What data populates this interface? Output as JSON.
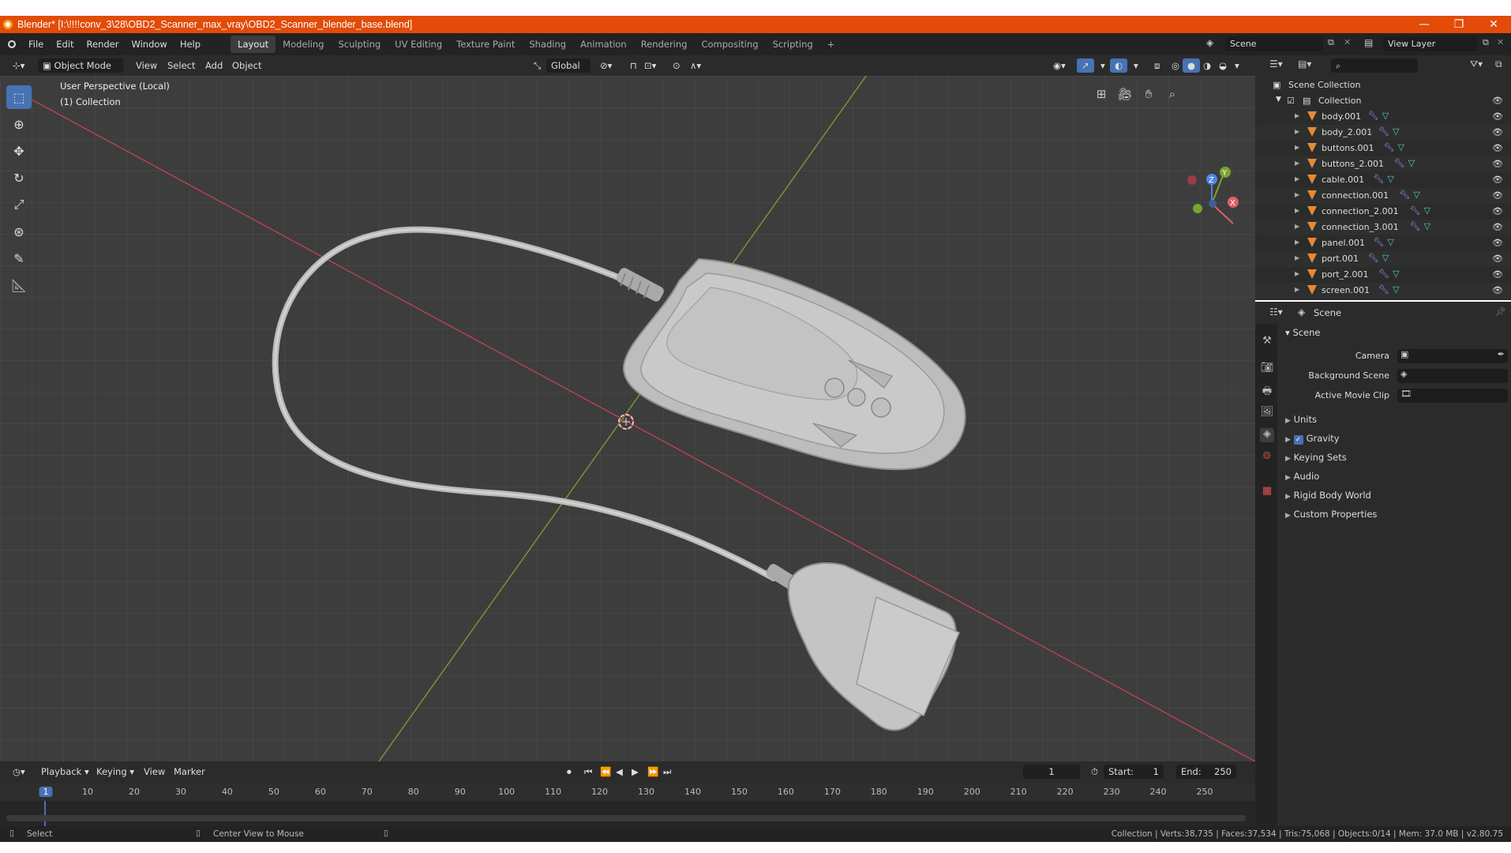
{
  "window": {
    "title": "Blender* [I:\\!!!!conv_3\\28\\OBD2_Scanner_max_vray\\OBD2_Scanner_blender_base.blend]",
    "minimize": "—",
    "maximize": "❐",
    "close": "✕"
  },
  "menu": {
    "items": [
      "File",
      "Edit",
      "Render",
      "Window",
      "Help"
    ],
    "workspaces": [
      "Layout",
      "Modeling",
      "Sculpting",
      "UV Editing",
      "Texture Paint",
      "Shading",
      "Animation",
      "Rendering",
      "Compositing",
      "Scripting"
    ],
    "add_tab": "+",
    "scene_label": "Scene",
    "view_layer_label": "View Layer"
  },
  "viewport_header": {
    "mode": "Object Mode",
    "menus": [
      "View",
      "Select",
      "Add",
      "Object"
    ],
    "orientation": "Global"
  },
  "viewport": {
    "perspective": "User Perspective (Local)",
    "collection": "(1) Collection",
    "gizmo": {
      "z": "Z",
      "y": "Y",
      "x": "X"
    }
  },
  "timeline": {
    "menus": [
      "Playback",
      "Keying",
      "View",
      "Marker"
    ],
    "current_frame": "1",
    "start_label": "Start:",
    "start": "1",
    "end_label": "End:",
    "end": "250",
    "ticks": [
      "1",
      "10",
      "20",
      "30",
      "40",
      "50",
      "60",
      "70",
      "80",
      "90",
      "100",
      "110",
      "120",
      "130",
      "140",
      "150",
      "160",
      "170",
      "180",
      "190",
      "200",
      "210",
      "220",
      "230",
      "240",
      "250"
    ]
  },
  "status": {
    "left": "Select",
    "middle": "Center View to Mouse",
    "right": "Collection | Verts:38,735 | Faces:37,534 | Tris:75,068 | Objects:0/14 | Mem: 37.0 MB | v2.80.75"
  },
  "outliner": {
    "root": "Scene Collection",
    "collection": "Collection",
    "objects": [
      "body.001",
      "body_2.001",
      "buttons.001",
      "buttons_2.001",
      "cable.001",
      "connection.001",
      "connection_2.001",
      "connection_3.001",
      "panel.001",
      "port.001",
      "port_2.001",
      "screen.001"
    ]
  },
  "properties": {
    "header": "Scene",
    "section": "Scene",
    "fields": {
      "camera": "Camera",
      "background_scene": "Background Scene",
      "active_movie_clip": "Active Movie Clip"
    },
    "subsections": [
      "Units",
      "Gravity",
      "Keying Sets",
      "Audio",
      "Rigid Body World",
      "Custom Properties"
    ]
  },
  "colors": {
    "title_bar": "#e24b08",
    "accent": "#4772b3",
    "x_axis": "#c8414f",
    "y_axis": "#7ba32f"
  }
}
